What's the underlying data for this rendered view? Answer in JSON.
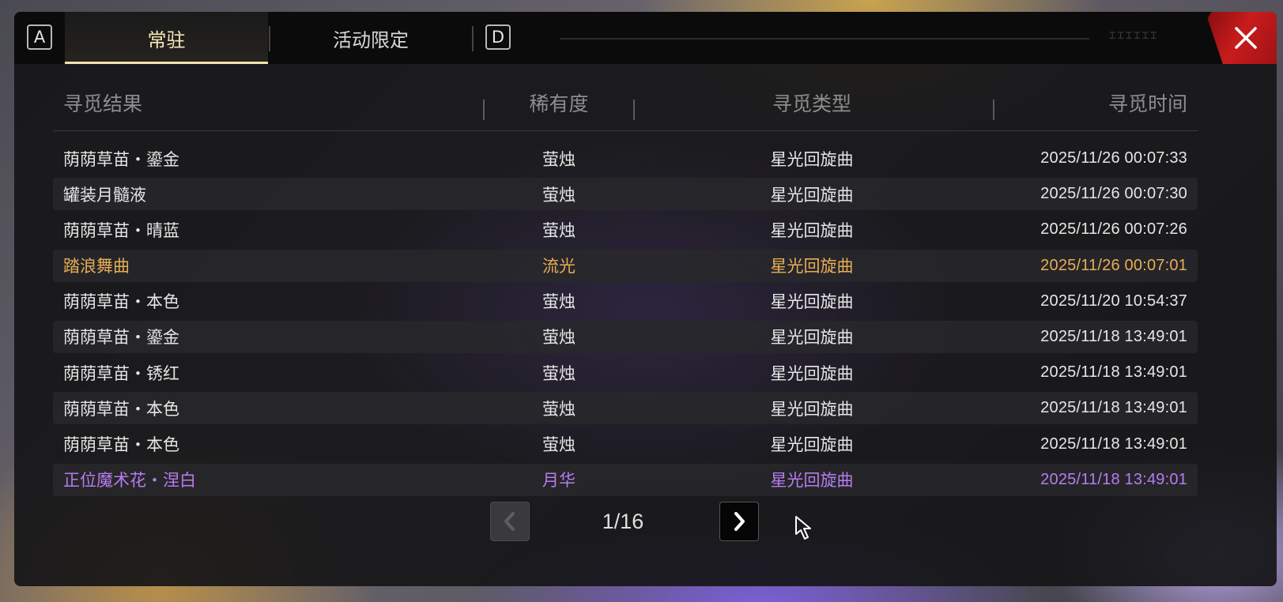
{
  "tabs": {
    "left_key": "A",
    "right_key": "D",
    "items": [
      {
        "label": "常驻"
      },
      {
        "label": "活动限定"
      }
    ]
  },
  "table": {
    "headers": [
      "寻觅结果",
      "稀有度",
      "寻觅类型",
      "寻觅时间"
    ],
    "rows": [
      {
        "name": "荫荫草苗・鎏金",
        "rarity": "萤烛",
        "type": "星光回旋曲",
        "time": "2025/11/26 00:07:33"
      },
      {
        "name": "罐装月髓液",
        "rarity": "萤烛",
        "type": "星光回旋曲",
        "time": "2025/11/26 00:07:30"
      },
      {
        "name": "荫荫草苗・晴蓝",
        "rarity": "萤烛",
        "type": "星光回旋曲",
        "time": "2025/11/26 00:07:26"
      },
      {
        "name": "踏浪舞曲",
        "rarity": "流光",
        "type": "星光回旋曲",
        "time": "2025/11/26 00:07:01"
      },
      {
        "name": "荫荫草苗・本色",
        "rarity": "萤烛",
        "type": "星光回旋曲",
        "time": "2025/11/20 10:54:37"
      },
      {
        "name": "荫荫草苗・鎏金",
        "rarity": "萤烛",
        "type": "星光回旋曲",
        "time": "2025/11/18 13:49:01"
      },
      {
        "name": "荫荫草苗・锈红",
        "rarity": "萤烛",
        "type": "星光回旋曲",
        "time": "2025/11/18 13:49:01"
      },
      {
        "name": "荫荫草苗・本色",
        "rarity": "萤烛",
        "type": "星光回旋曲",
        "time": "2025/11/18 13:49:01"
      },
      {
        "name": "荫荫草苗・本色",
        "rarity": "萤烛",
        "type": "星光回旋曲",
        "time": "2025/11/18 13:49:01"
      },
      {
        "name": "正位魔术花・涅白",
        "rarity": "月华",
        "type": "星光回旋曲",
        "time": "2025/11/18 13:49:01"
      }
    ]
  },
  "pagination": {
    "current": "1/16"
  },
  "colors": {
    "gold_rarity": "#e9ad55",
    "purple_rarity": "#b77cf0",
    "active_tab": "#f5e7b6",
    "close_red": "#c81c1c"
  },
  "icons": {
    "close": "close-icon",
    "prev": "chevron-left-icon",
    "next": "chevron-right-icon",
    "cursor": "mouse-cursor-icon"
  }
}
